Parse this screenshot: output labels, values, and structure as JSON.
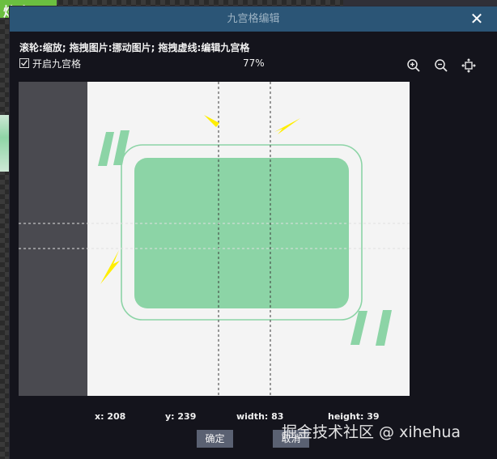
{
  "background": {
    "logo_text": "炫窗"
  },
  "dialog": {
    "title": "九宫格编辑",
    "close_glyph": "✕",
    "hint": "滚轮:缩放;  拖拽图片:挪动图片;  拖拽虚线:编辑九宫格",
    "nine_grid_toggle": {
      "label": "开启九宫格",
      "checked": true
    },
    "zoom": "77%",
    "toolbar": {
      "zoom_in_icon": "zoom-in-icon",
      "zoom_out_icon": "zoom-out-icon",
      "fit_icon": "fit-to-view-icon"
    },
    "info": {
      "x": "x: 208",
      "y": "y: 239",
      "width": "width: 83",
      "height": "height: 39"
    },
    "buttons": {
      "ok": "确定",
      "cancel": "取消"
    }
  },
  "colors": {
    "titlebar": "#2b5576",
    "canvas_bg": "#4a4a50",
    "image_bg": "#f4f4f4",
    "shape_green": "#8cd4a6",
    "arrow_yellow": "#ffee00"
  },
  "watermark": "掘金技术社区 @ xihehua"
}
